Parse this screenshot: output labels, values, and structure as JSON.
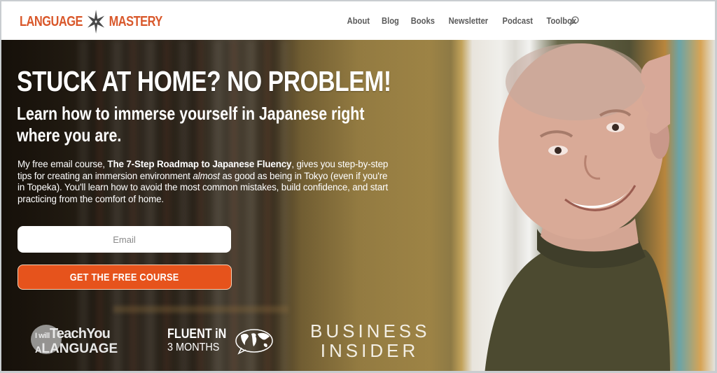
{
  "header": {
    "logo": {
      "left_text": "LANGUAGE",
      "right_text": "MASTERY",
      "icon": "shuriken-star-icon",
      "color": "#d9582b"
    },
    "nav": [
      {
        "label": "About"
      },
      {
        "label": "Blog"
      },
      {
        "label": "Books"
      },
      {
        "label": "Newsletter"
      },
      {
        "label": "Podcast"
      },
      {
        "label": "Toolbox"
      }
    ],
    "search_icon": "search-icon"
  },
  "hero": {
    "title": "STUCK AT HOME? NO PROBLEM!",
    "subtitle": "Learn how to immerse yourself in Japanese right where you are.",
    "body": {
      "part1": "My free email course, ",
      "course_name": "The 7-Step Roadmap to Japanese Fluency",
      "part2": ", gives you step-by-step tips for creating an immersion environment ",
      "emphasis": "almost",
      "part3": " as good as being in Tokyo (even if you're in Topeka). You'll learn how to avoid the most common mistakes, build confidence, and start practicing from the comfort of home."
    },
    "email_placeholder": "Email",
    "cta_label": "GET THE FREE COURSE",
    "cta_color": "#e6531c"
  },
  "press": {
    "itya": {
      "line1_small": "I will",
      "line1_big": "TeachYou",
      "line2_small": "A",
      "line2_big": "LANGUAGE"
    },
    "fi3m": {
      "line1": "FLUENT iN",
      "line2": "3 MONTHS",
      "icon": "world-map-bubble-icon"
    },
    "bi": {
      "line1": "BUSINESS",
      "line2": "INSIDER"
    }
  }
}
